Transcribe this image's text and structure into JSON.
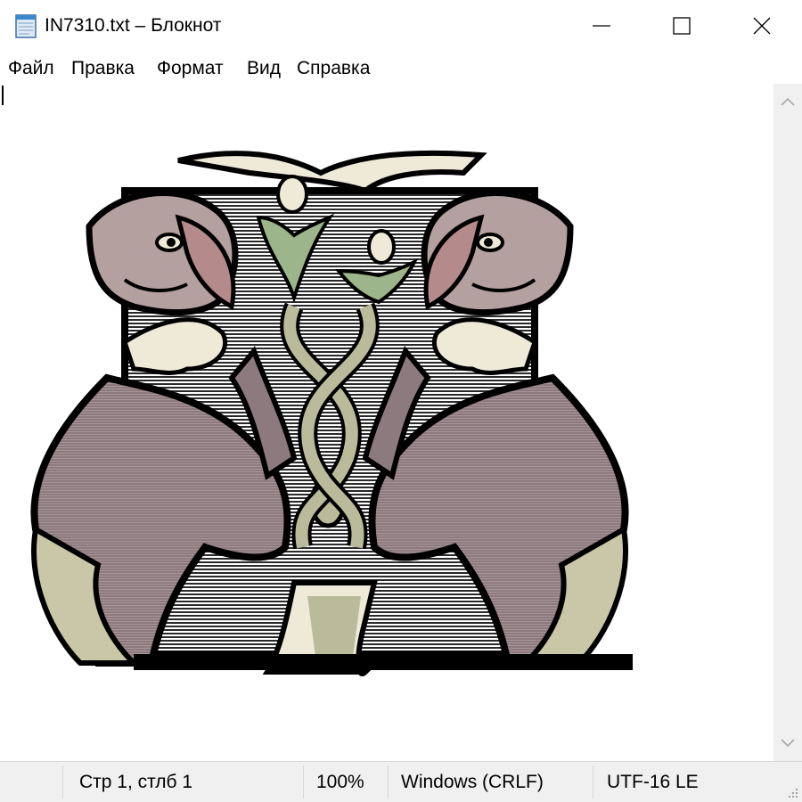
{
  "window": {
    "title": "IN7310.txt – Блокнот",
    "app_icon": "notepad-icon",
    "controls": [
      "minimize-icon",
      "maximize-icon",
      "close-icon"
    ]
  },
  "menu": {
    "items": [
      {
        "label": "Файл"
      },
      {
        "label": "Правка"
      },
      {
        "label": "Формат"
      },
      {
        "label": "Вид"
      },
      {
        "label": "Справка"
      }
    ]
  },
  "editor": {
    "content": "ASCII/ANSI art: two mirrored heraldic lions (dogs) facing each other around a central interlaced knot column",
    "scrollbar": {
      "up_icon": "chevron-up-icon",
      "down_icon": "chevron-down-icon"
    }
  },
  "status": {
    "position": "Стр 1, стлб 1",
    "zoom": "100%",
    "line_endings": "Windows (CRLF)",
    "encoding": "UTF-16 LE"
  },
  "colors": {
    "body": "#8d7a7f",
    "body_dark": "#6e5c63",
    "ear": "#b58a8a",
    "cream": "#efe9d8",
    "green": "#9db58a",
    "knot": "#b9bb9a",
    "outline": "#000000",
    "stripe": "#2a2a2a"
  }
}
